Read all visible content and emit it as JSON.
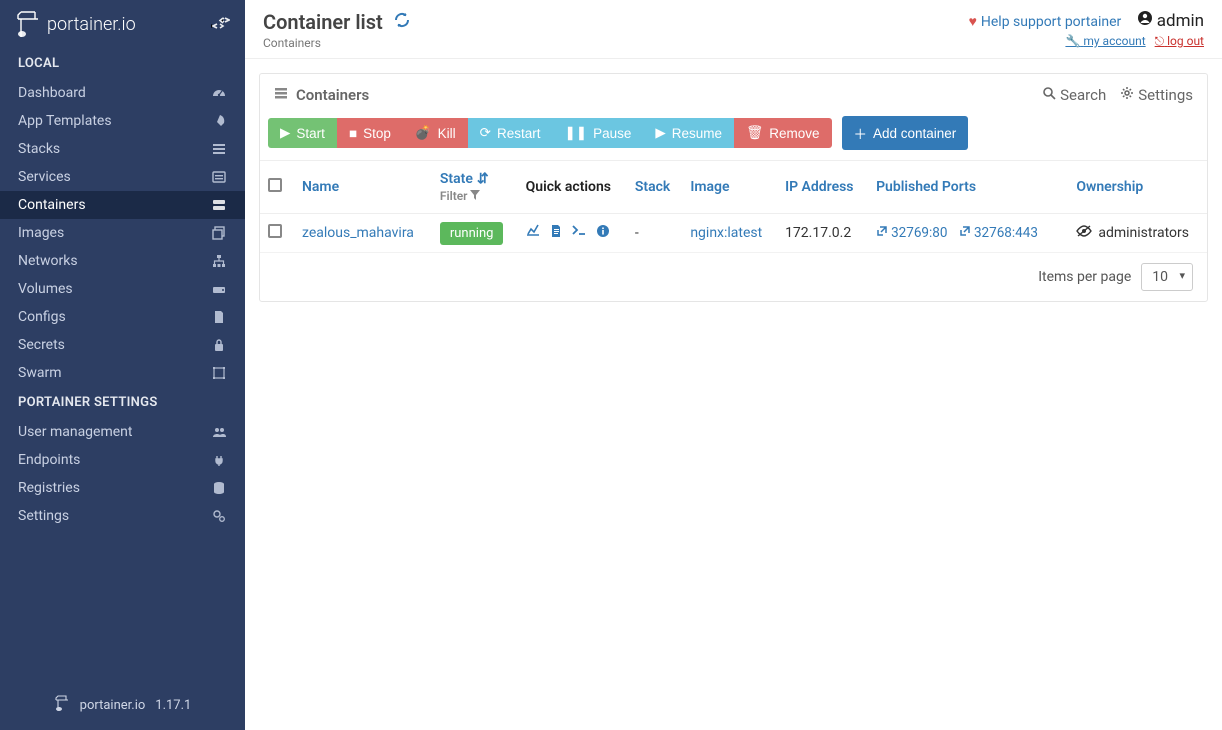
{
  "brand": "portainer.io",
  "version": "1.17.1",
  "sidebar": {
    "sections": [
      {
        "title": "LOCAL",
        "items": [
          {
            "label": "Dashboard",
            "icon": "tachometer-icon"
          },
          {
            "label": "App Templates",
            "icon": "rocket-icon"
          },
          {
            "label": "Stacks",
            "icon": "list-icon"
          },
          {
            "label": "Services",
            "icon": "list-alt-icon"
          },
          {
            "label": "Containers",
            "icon": "server-icon",
            "active": true
          },
          {
            "label": "Images",
            "icon": "clone-icon"
          },
          {
            "label": "Networks",
            "icon": "sitemap-icon"
          },
          {
            "label": "Volumes",
            "icon": "hdd-icon"
          },
          {
            "label": "Configs",
            "icon": "file-icon"
          },
          {
            "label": "Secrets",
            "icon": "lock-icon"
          },
          {
            "label": "Swarm",
            "icon": "object-group-icon"
          }
        ]
      },
      {
        "title": "PORTAINER SETTINGS",
        "items": [
          {
            "label": "User management",
            "icon": "users-icon"
          },
          {
            "label": "Endpoints",
            "icon": "plug-icon"
          },
          {
            "label": "Registries",
            "icon": "database-icon"
          },
          {
            "label": "Settings",
            "icon": "cogs-icon"
          }
        ]
      }
    ]
  },
  "header": {
    "title": "Container list",
    "breadcrumb": "Containers",
    "support": "Help support portainer",
    "user": "admin",
    "my_account": "my account",
    "logout": "log out"
  },
  "panel": {
    "title": "Containers",
    "search": "Search",
    "settings": "Settings"
  },
  "toolbar": {
    "start": "Start",
    "stop": "Stop",
    "kill": "Kill",
    "restart": "Restart",
    "pause": "Pause",
    "resume": "Resume",
    "remove": "Remove",
    "add": "Add container"
  },
  "columns": {
    "name": "Name",
    "state": "State",
    "filter": "Filter",
    "quick": "Quick actions",
    "stack": "Stack",
    "image": "Image",
    "ip": "IP Address",
    "ports": "Published Ports",
    "owner": "Ownership"
  },
  "rows": [
    {
      "name": "zealous_mahavira",
      "state": "running",
      "stack": "-",
      "image": "nginx:latest",
      "ip": "172.17.0.2",
      "ports": [
        "32769:80",
        "32768:443"
      ],
      "owner": "administrators"
    }
  ],
  "pager": {
    "label": "Items per page",
    "value": "10"
  }
}
